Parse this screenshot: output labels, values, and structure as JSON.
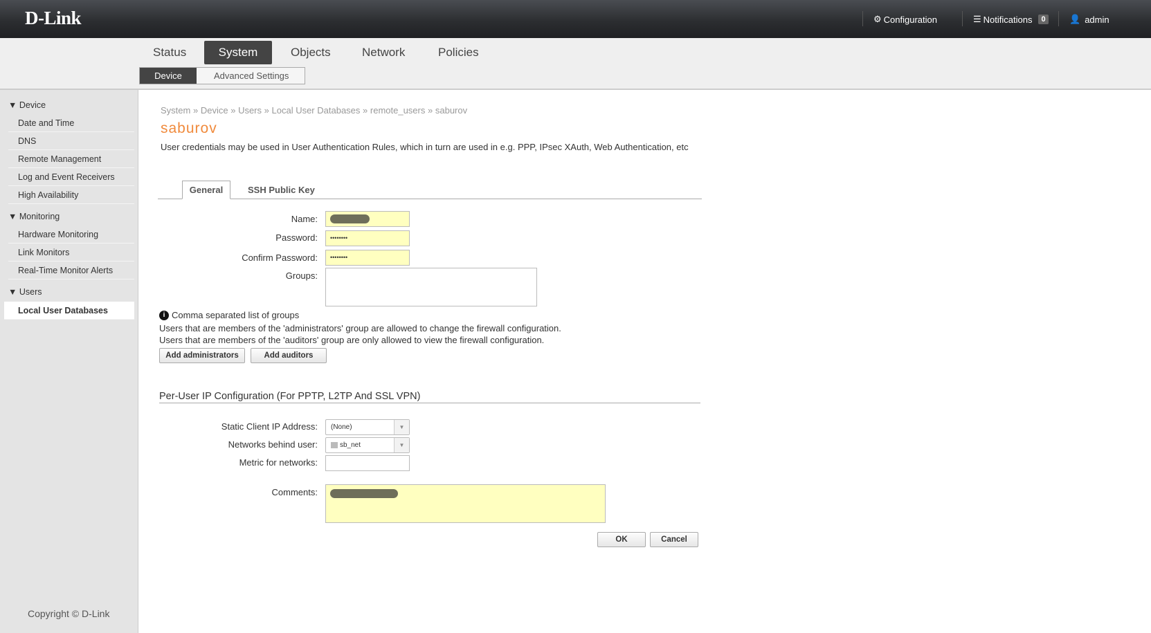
{
  "header": {
    "logo": "D-Link",
    "configuration": "Configuration",
    "notifications": "Notifications",
    "notification_count": "0",
    "user": "admin"
  },
  "main_tabs": [
    "Status",
    "System",
    "Objects",
    "Network",
    "Policies"
  ],
  "sub_tabs": [
    "Device",
    "Advanced Settings"
  ],
  "sidebar": {
    "groups": [
      {
        "label": "Device",
        "items": [
          "Date and Time",
          "DNS",
          "Remote Management",
          "Log and Event Receivers",
          "High Availability"
        ]
      },
      {
        "label": "Monitoring",
        "items": [
          "Hardware Monitoring",
          "Link Monitors",
          "Real-Time Monitor Alerts"
        ]
      },
      {
        "label": "Users",
        "items": [
          "Local User Databases"
        ]
      }
    ],
    "copyright": "Copyright © D-Link"
  },
  "breadcrumb": [
    "System",
    "Device",
    "Users",
    "Local User Databases",
    "remote_users",
    "saburov"
  ],
  "page": {
    "title": "saburov",
    "description": "User credentials may be used in User Authentication Rules, which in turn are used in e.g. PPP, IPsec XAuth, Web Authentication, etc"
  },
  "tabs": [
    "General",
    "SSH Public Key"
  ],
  "form": {
    "name_label": "Name:",
    "password_label": "Password:",
    "password_value": "••••••••",
    "confirm_label": "Confirm Password:",
    "confirm_value": "••••••••",
    "groups_label": "Groups:",
    "info": "Comma separated list of groups",
    "help1": "Users that are members of the 'administrators' group are allowed to change the firewall configuration.",
    "help2": "Users that are members of the 'auditors' group are only allowed to view the firewall configuration.",
    "add_admins": "Add administrators",
    "add_auditors": "Add auditors",
    "section": "Per-User IP Configuration (For PPTP, L2TP And SSL VPN)",
    "static_ip_label": "Static Client IP Address:",
    "static_ip_value": "(None)",
    "networks_label": "Networks behind user:",
    "networks_value": "sb_net",
    "metric_label": "Metric for networks:",
    "comments_label": "Comments:",
    "ok": "OK",
    "cancel": "Cancel"
  }
}
